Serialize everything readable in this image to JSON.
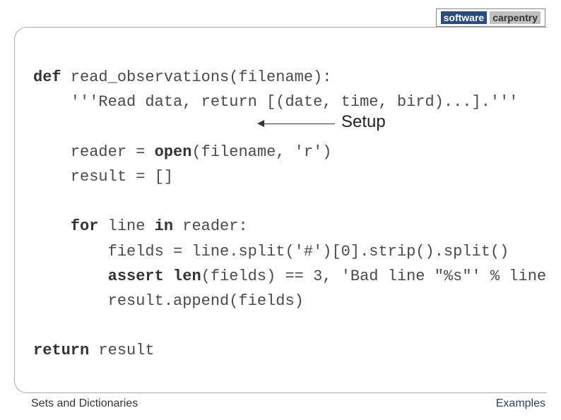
{
  "logo": {
    "left": "software",
    "right": "carpentry"
  },
  "code": {
    "l1a": "def",
    "l1b": " read_observations(filename):",
    "l2": "    '''Read data, return [(date, time, bird)...].'''",
    "l3": "",
    "l4a": "    reader = ",
    "l4b": "open",
    "l4c": "(filename, 'r')",
    "l5": "    result = []",
    "l6": "",
    "l7a": "    ",
    "l7b": "for",
    "l7c": " line ",
    "l7d": "in",
    "l7e": " reader:",
    "l8": "        fields = line.split('#')[0].strip().split()",
    "l9a": "        ",
    "l9b": "assert",
    "l9c": " ",
    "l9d": "len",
    "l9e": "(fields) == 3, 'Bad line \"%s\"' % line",
    "l10": "        result.append(fields)",
    "l11": "",
    "l12a": "return",
    "l12b": " result"
  },
  "annotation": "Setup",
  "footer": {
    "left": "Sets and Dictionaries",
    "right": "Examples"
  }
}
